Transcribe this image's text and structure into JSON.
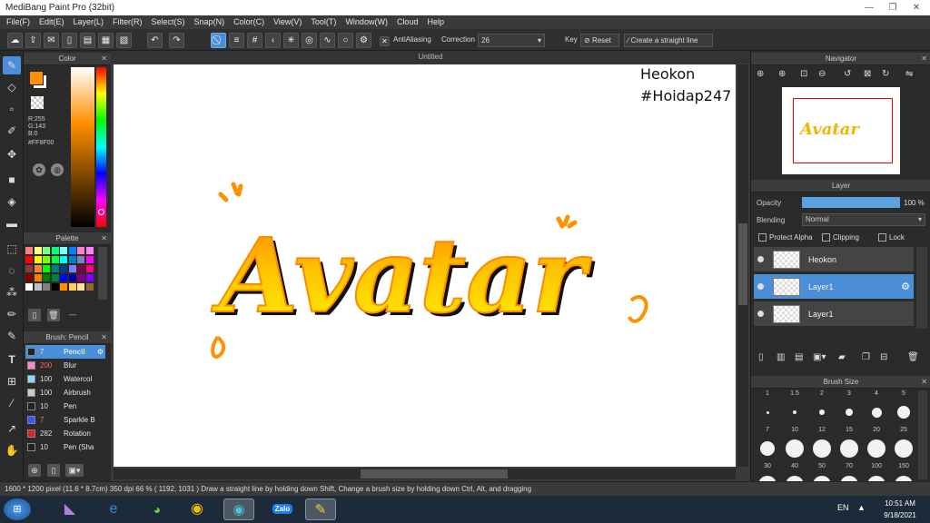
{
  "window": {
    "title": "MediBang Paint Pro (32bit)",
    "minimize": "—",
    "restore": "❐",
    "close": "✕"
  },
  "menu": [
    "File(F)",
    "Edit(E)",
    "Layer(L)",
    "Filter(R)",
    "Select(S)",
    "Snap(N)",
    "Color(C)",
    "View(V)",
    "Tool(T)",
    "Window(W)",
    "Cloud",
    "Help"
  ],
  "toolbar": {
    "antialiasing_label": "AntiAliasing",
    "correction_label": "Correction",
    "correction_value": "26",
    "key_label": "Key",
    "reset_label": "Reset",
    "straight_line_label": "Create a straight line"
  },
  "color_panel": {
    "title": "Color",
    "r": "R:255",
    "g": "G:143",
    "b": "B:0",
    "hex": "#FF8F00",
    "fg_color": "#ff8f00",
    "bg_color": "#ffffff"
  },
  "palette_panel": {
    "title": "Palette",
    "label": "---",
    "swatches": [
      "#ff8080",
      "#ffff80",
      "#80ff80",
      "#00ff80",
      "#80ffff",
      "#0080ff",
      "#ff80c0",
      "#ff80ff",
      "#ff0000",
      "#ffff00",
      "#80ff00",
      "#00ff40",
      "#00ffff",
      "#0080c0",
      "#8080c0",
      "#ff00ff",
      "#804040",
      "#ff8040",
      "#00ff00",
      "#008080",
      "#004080",
      "#8080ff",
      "#800040",
      "#ff0080",
      "#800000",
      "#ff8000",
      "#008000",
      "#008040",
      "#0000ff",
      "#0000a0",
      "#800080",
      "#8000ff",
      "#ffffff",
      "#c0c0c0",
      "#808080",
      "#000000",
      "#ff8f00",
      "#ffcc66",
      "#ffe0a0",
      "#996633"
    ]
  },
  "brush_panel": {
    "title": "Brush: Pencil",
    "items": [
      {
        "size": "7",
        "name": "Pencil",
        "color": "#222222",
        "selected": true
      },
      {
        "size": "200",
        "name": "Blur",
        "color": "#ff88cc",
        "selected": false
      },
      {
        "size": "100",
        "name": "Watercol",
        "color": "#88ddff",
        "selected": false
      },
      {
        "size": "100",
        "name": "Airbrush",
        "color": "#cccccc",
        "selected": false
      },
      {
        "size": "10",
        "name": "Pen",
        "color": "#222222",
        "selected": false
      },
      {
        "size": "7",
        "name": "Sparkle B",
        "color": "#3355ff",
        "selected": false
      },
      {
        "size": "282",
        "name": "Rotation",
        "color": "#dd2222",
        "selected": false
      },
      {
        "size": "10",
        "name": "Pen (Sha",
        "color": "#222222",
        "selected": false
      }
    ]
  },
  "document": {
    "tab": "Untitled",
    "artwork_word": "Avatar",
    "watermark_line1": "Heokon",
    "watermark_line2": "#Hoidap247"
  },
  "navigator": {
    "title": "Navigator"
  },
  "layer_panel": {
    "title": "Layer",
    "opacity_label": "Opacity",
    "opacity_value": "100 %",
    "opacity_percent": 100,
    "blending_label": "Blending",
    "blending_value": "Normal",
    "protect_alpha": "Protect Alpha",
    "clipping": "Clipping",
    "lock": "Lock",
    "layers": [
      {
        "name": "Heokon",
        "selected": false
      },
      {
        "name": "Layer1",
        "selected": true
      },
      {
        "name": "Layer1",
        "selected": false
      }
    ]
  },
  "brush_size_panel": {
    "title": "Brush Size",
    "sizes": [
      "1",
      "1.5",
      "2",
      "3",
      "4",
      "5",
      "7",
      "10",
      "12",
      "15",
      "20",
      "25",
      "30",
      "40",
      "50",
      "70",
      "100",
      "150"
    ]
  },
  "status": {
    "text": "1600 * 1200 pixel   (11.6 * 8.7cm)   350 dpi   66 %   ( 1192, 1031 )   Draw a straight line by holding down Shift, Change a brush size by holding down Ctrl, Alt, and dragging"
  },
  "taskbar": {
    "lang": "EN",
    "time": "10:51 AM",
    "date": "9/18/2021",
    "zalo": "Zalo"
  }
}
